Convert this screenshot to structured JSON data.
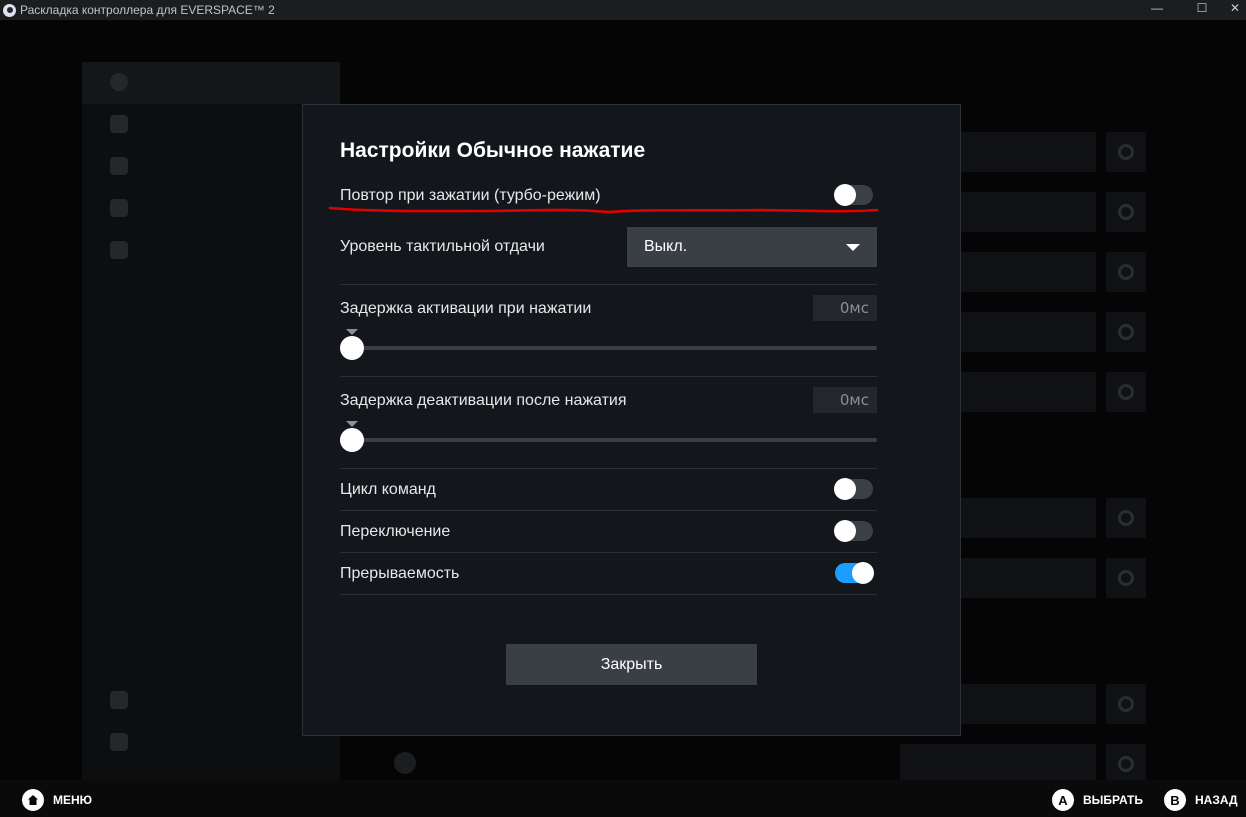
{
  "window": {
    "title": "Раскладка контроллера для EVERSPACE™ 2",
    "minimize_glyph": "—",
    "maximize_glyph": "☐",
    "close_glyph": "✕"
  },
  "modal": {
    "title": "Настройки Обычное нажатие",
    "turbo_label": "Повтор при зажатии (турбо-режим)",
    "turbo_on": false,
    "haptics_label": "Уровень тактильной отдачи",
    "haptics_value": "Выкл.",
    "activation_delay_label": "Задержка активации при нажатии",
    "activation_delay_value": "0мс",
    "activation_delay_level": 0,
    "deactivation_delay_label": "Задержка деактивации после нажатия",
    "deactivation_delay_value": "0мс",
    "deactivation_delay_level": 0,
    "cycle_label": "Цикл команд",
    "cycle_on": false,
    "toggle_label": "Переключение",
    "toggle_on": false,
    "interruptible_label": "Прерываемость",
    "interruptible_on": true,
    "close_label": "Закрыть"
  },
  "footer": {
    "menu_label": "МЕНЮ",
    "menu_icon": "home-icon",
    "select_glyph": "A",
    "select_label": "ВЫБРАТЬ",
    "back_glyph": "B",
    "back_label": "НАЗАД"
  },
  "colors": {
    "accent": "#1a9fff",
    "annotation": "#e00000",
    "modal_bg": "#13161b"
  }
}
